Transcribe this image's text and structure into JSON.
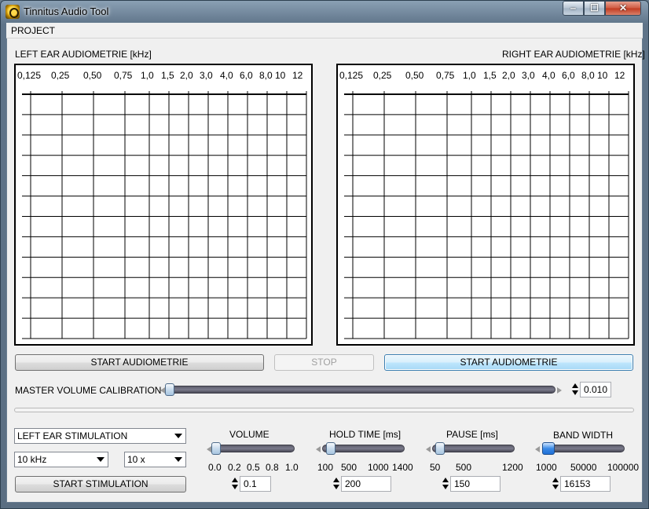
{
  "window": {
    "title": "Tinnitus Audio Tool",
    "minimize": "‒",
    "maximize": "☐",
    "close": "✕"
  },
  "menu": {
    "project": "PROJECT"
  },
  "left_panel": {
    "label": "LEFT EAR AUDIOMETRIE [kHz]",
    "frequencies": [
      "0,125",
      "0,25",
      "0,50",
      "0,75",
      "1,0",
      "1,5",
      "2,0",
      "3,0",
      "4,0",
      "6,0",
      "8,0",
      "10",
      "12"
    ]
  },
  "right_panel": {
    "label": "RIGHT EAR AUDIOMETRIE [kHz]",
    "frequencies": [
      "0,125",
      "0,25",
      "0,50",
      "0,75",
      "1,0",
      "1,5",
      "2,0",
      "3,0",
      "4,0",
      "6,0",
      "8,0",
      "10",
      "12"
    ]
  },
  "buttons": {
    "start_left": "START AUDIOMETRIE",
    "stop": "STOP",
    "start_right": "START AUDIOMETRIE",
    "start_stimulation": "START STIMULATION"
  },
  "master_volume": {
    "label": "MASTER VOLUME CALIBRATION",
    "value": "0.010",
    "level": 0.01
  },
  "stimulation": {
    "ear_select": "LEFT EAR STIMULATION",
    "freq_select": "10 kHz",
    "mult_select": "10 x"
  },
  "volume": {
    "label": "VOLUME",
    "scale": [
      "0.0",
      "0.2",
      "0.5",
      "0.8",
      "1.0"
    ],
    "value": "0.1"
  },
  "hold_time": {
    "label": "HOLD TIME [ms]",
    "scale": [
      "100",
      "500",
      "1000",
      "1400"
    ],
    "value": "200"
  },
  "pause": {
    "label": "PAUSE [ms]",
    "scale": [
      "50",
      "500",
      "1200"
    ],
    "value": "150"
  },
  "band_width": {
    "label": "BAND WIDTH",
    "scale": [
      "1000",
      "50000",
      "100000"
    ],
    "value": "16153"
  },
  "colors": {
    "client_bg": "#f0f0f0",
    "grid_line": "#000000",
    "focused_button": "#a7d9f5"
  }
}
